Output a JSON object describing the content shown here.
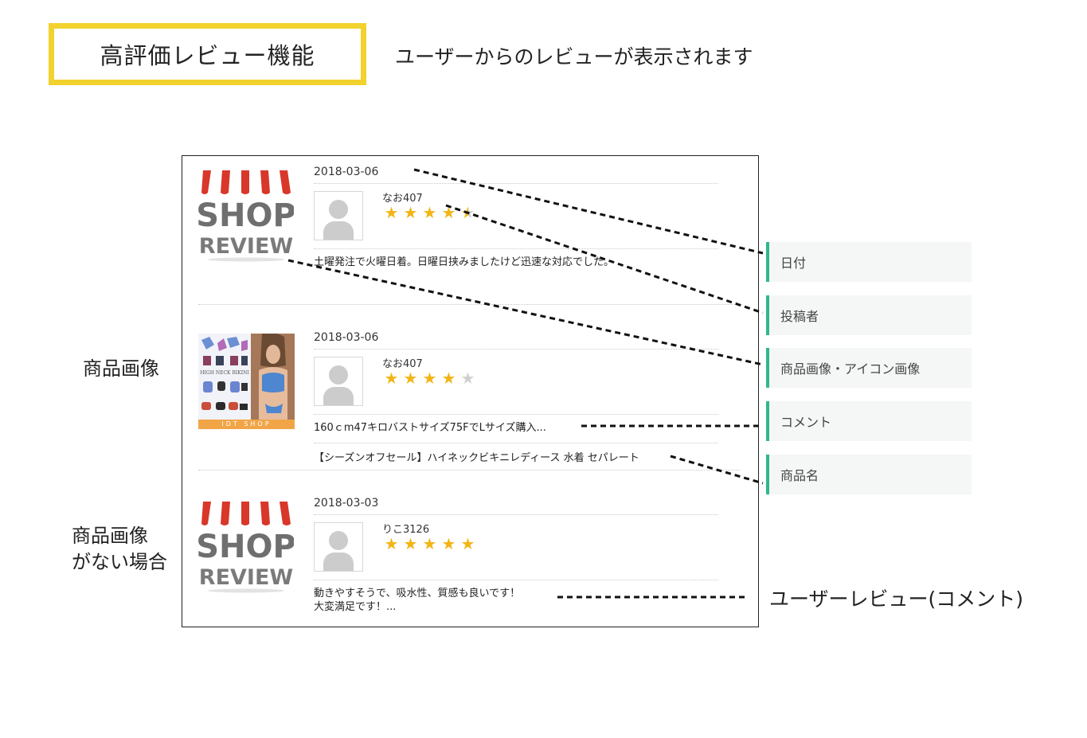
{
  "header": {
    "title": "高評価レビュー機能",
    "subtitle": "ユーザーからのレビューが表示されます"
  },
  "left_labels": {
    "product_image": "商品画像",
    "no_image_line1": "商品画像",
    "no_image_line2": "がない場合"
  },
  "logo": {
    "line1": "SHOP",
    "line2": "REVIEW"
  },
  "reviews": [
    {
      "date": "2018-03-06",
      "user": "なお407",
      "rating": 4.5,
      "stars": [
        "on",
        "on",
        "on",
        "on",
        "half"
      ],
      "comment": "土曜発注で火曜日着。日曜日挟みましたけど迅速な対応でした。",
      "product": ""
    },
    {
      "date": "2018-03-06",
      "user": "なお407",
      "rating": 4,
      "stars": [
        "on",
        "on",
        "on",
        "on",
        "off"
      ],
      "comment": "160ｃm47キロバストサイズ75FでLサイズ購入...",
      "product": "【シーズンオフセール】ハイネックビキニレディース 水着 セパレート",
      "image_caption": "IDT SHOP",
      "image_text": "HIGH NECK BIKINI"
    },
    {
      "date": "2018-03-03",
      "user": "りこ3126",
      "rating": 5,
      "stars": [
        "on",
        "on",
        "on",
        "on",
        "on"
      ],
      "comment_line1": "動きやすそうで、吸水性、質感も良いです！",
      "comment_line2": "大変満足です！..."
    }
  ],
  "tags": {
    "date": "日付",
    "poster": "投稿者",
    "image": "商品画像・アイコン画像",
    "comment": "コメント",
    "product_name": "商品名"
  },
  "right_label": "ユーザーレビュー(コメント)",
  "colors": {
    "title_border": "#f2d22e",
    "tag_accent": "#2fb78e",
    "star_on": "#f2b515",
    "star_off": "#cfcfcf",
    "awning_red": "#d8372a"
  }
}
